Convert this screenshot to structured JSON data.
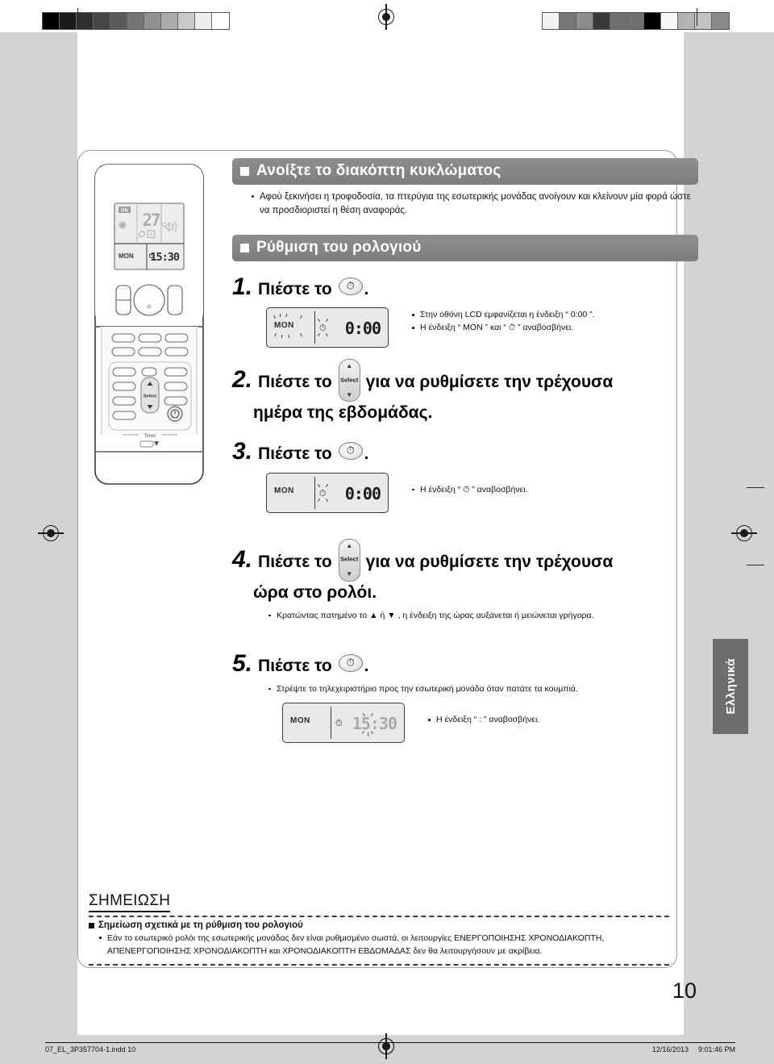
{
  "document": {
    "page_number": "10",
    "language_tab": "Ελληνικά"
  },
  "sections": [
    {
      "id": "breaker",
      "heading": "Ανοίξτε το διακόπτη κυκλώματος",
      "bullet": "Αφού ξεκινήσει η τροφοδοσία, τα πτερύγια της εσωτερικής μονάδας ανοίγουν και κλείνουν μία φορά ώστε να προσδιοριστεί η θέση αναφοράς."
    },
    {
      "id": "clock-setting",
      "heading": "Ρύθμιση του ρολογιού"
    }
  ],
  "steps": [
    {
      "num": "1.",
      "text": "Πιέστε το",
      "button": "clock-button",
      "trailing": ".",
      "lcd": {
        "day": "MON",
        "time": "0:00",
        "clock_icon": "⏱",
        "day_blinks": true,
        "icon_blinks": true
      },
      "notes": [
        "Στην οθόνη LCD εμφανίζεται η ένδειξη “ 0:00 ”.",
        "Η ένδειξη “ MON ” και “ ⏱ ” αναβοσβήνει."
      ]
    },
    {
      "num": "2.",
      "text_before": "Πιέστε το",
      "button": "select-button",
      "button_label": "Select",
      "text_after": "για να ρυθμίσετε την τρέχουσα",
      "text_line2": "ημέρα της εβδομάδας."
    },
    {
      "num": "3.",
      "text": "Πιέστε το",
      "button": "clock-button",
      "trailing": ".",
      "lcd": {
        "day": "MON",
        "time": "0:00",
        "clock_icon": "⏱",
        "day_blinks": false,
        "icon_blinks": true
      },
      "notes": [
        "Η ένδειξη “ ⏱ ” αναβοσβήνει."
      ]
    },
    {
      "num": "4.",
      "text_before": "Πιέστε το",
      "button": "select-button",
      "button_label": "Select",
      "text_after": "για να ρυθμίσετε την τρέχουσα",
      "text_line2": "ώρα στο ρολόι.",
      "notes": [
        "Κρατώντας πατημένο το ▲ ή ▼ , η ένδειξη της ώρας αυξάνεται ή μειώνεται γρήγορα."
      ]
    },
    {
      "num": "5.",
      "text": "Πιέστε το",
      "button": "clock-button",
      "trailing": ".",
      "note_top": "Στρέψτε το τηλεχειριστήριο προς την εσωτερική μονάδα όταν πατάτε τα κουμπιά.",
      "lcd": {
        "day": "MON",
        "time": "15:30",
        "clock_icon": "⏱",
        "day_blinks": false,
        "colon_blinks": true,
        "dim": true
      },
      "notes": [
        "Η ένδειξη “ : ” αναβοσβήνει."
      ]
    }
  ],
  "notice": {
    "title": "ΣΗΜΕΙΩΣΗ",
    "subtitle": "Σημείωση σχετικά με τη ρύθμιση του ρολογιού",
    "body": "Εάν το εσωτερικό ρολόι της εσωτερικής μονάδας δεν είναι ρυθμισμένο σωστά, οι λειτουργίες ΕΝΕΡΓΟΠΟΙΗΣΗΣ ΧΡΟΝΟΔΙΑΚΟΠΤΗ, ΑΠΕΝΕΡΓΟΠΟΙΗΣΗΣ ΧΡΟΝΟΔΙΑΚΟΠΤΗ και ΧΡΟΝΟΔΙΑΚΟΠΤΗ ΕΒΔΟΜΑΔΑΣ δεν θα λειτουργήσουν με ακρίβεια."
  },
  "remote": {
    "lcd": {
      "on_badge": "ON",
      "temperature": "27",
      "unit": "°C",
      "day": "MON",
      "time": "15:30",
      "mode_icon": "snowflake-icon",
      "fan_icon": "fan-icon",
      "auto_badge": "A",
      "airflow_icon": "airflow-icon"
    },
    "select_label": "Select",
    "timer_label": "Timer"
  },
  "footer": {
    "file": "07_EL_3P357704-1.indd   10",
    "date": "12/16/2013",
    "time": "9:01:46 PM"
  },
  "colorbars": {
    "left": [
      "#000000",
      "#1b1b1b",
      "#303030",
      "#464646",
      "#5b5b5b",
      "#757575",
      "#909090",
      "#ababab",
      "#c9c9c9",
      "#eeeeee",
      "#ffffff"
    ],
    "right": [
      "#f2f2f2",
      "#767676",
      "#8c8c8c",
      "#3a3a3a",
      "#6f6f6f",
      "#707070",
      "#000000",
      "#f7f7f7",
      "#b3b3b3",
      "#c2c2c2",
      "#8a8a8a"
    ]
  }
}
